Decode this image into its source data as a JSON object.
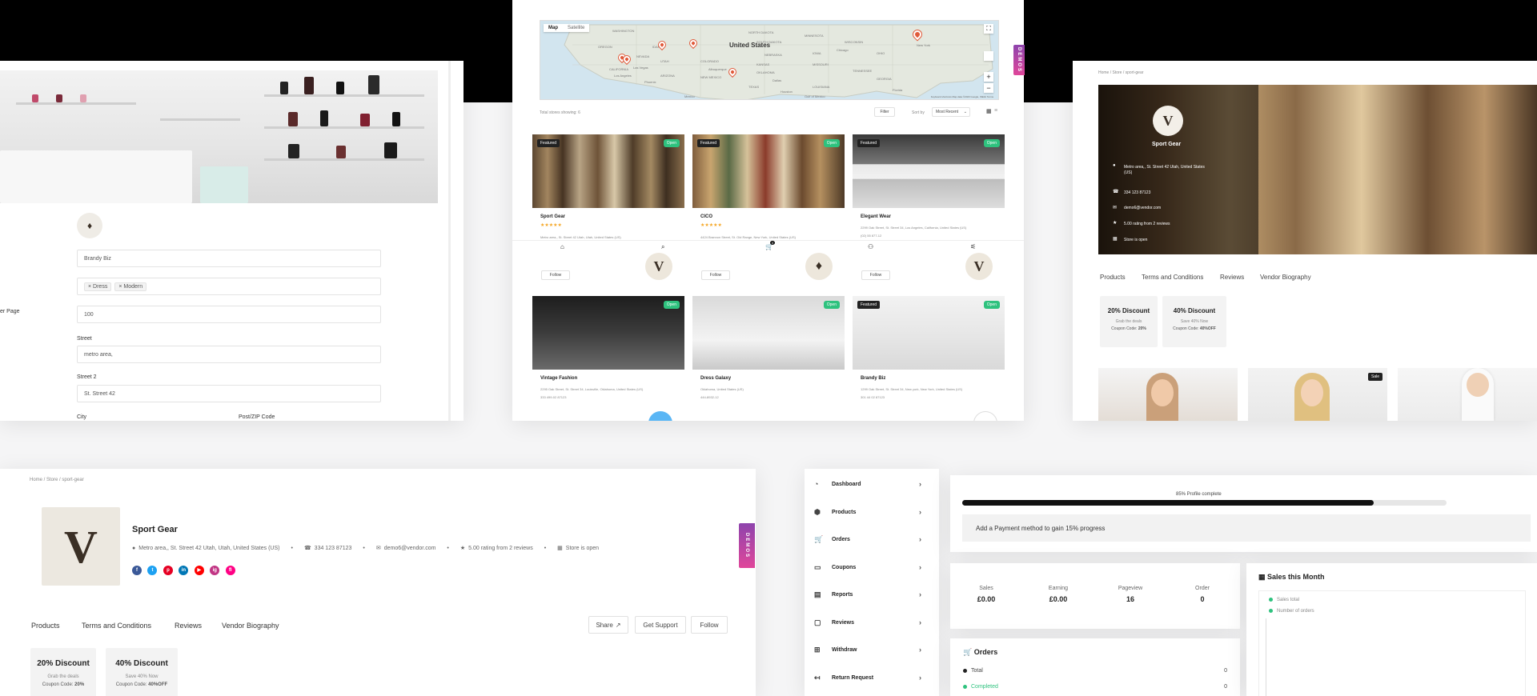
{
  "colors": {
    "accent_green": "#2ec27e",
    "star": "#f5a623",
    "demos_gradient_start": "#8e44ad",
    "demos_gradient_end": "#e0469a",
    "progress_fill": "#111111",
    "pin": "#e05a3a"
  },
  "settings_card": {
    "section_label": "er Page",
    "store_name": "Brandy Biz",
    "categories": [
      "Dress",
      "Modern"
    ],
    "per_page": "100",
    "street_label": "Street",
    "street_value": "metro area,",
    "street2_label": "Street 2",
    "street2_value": "St. Street 42",
    "city_label": "City",
    "zip_label": "Post/ZIP Code",
    "category_remove": "×",
    "logo_icon": "store-logo-icon"
  },
  "listing_card": {
    "map": {
      "tab_map": "Map",
      "tab_satellite": "Satellite",
      "country_label": "United States",
      "zoom_in": "+",
      "zoom_out": "−",
      "footer": "Keyboard shortcuts  Map data ©2023 Google, INEGI  Terms",
      "place_labels": [
        "WASHINGTON",
        "NORTH DAKOTA",
        "MINNESOTA",
        "OREGON",
        "IDAHO",
        "SOUTH DAKOTA",
        "WISCONSIN",
        "NEVADA",
        "NEBRASKA",
        "IOWA",
        "OHIO",
        "UTAH",
        "COLORADO",
        "KANSAS",
        "MISSOURI",
        "CALIFORNIA",
        "Las Vegas",
        "OKLAHOMA",
        "TENNESSEE",
        "ARIZONA",
        "NEW MEXICO",
        "Dallas",
        "GEORGIA",
        "TEXAS",
        "LOUISIANA",
        "Houston",
        "Phoenix",
        "Albuquerque",
        "New York",
        "Chicago",
        "Los Angeles",
        "Mexico",
        "Gulf of Mexico",
        "Florida"
      ]
    },
    "total_stores": "Total stores showing: 6",
    "filter_label": "Filter",
    "sort_label": "Sort by",
    "sort_value": "Most Recent",
    "featured_label": "Featured",
    "open_label": "Open",
    "follow_label": "Follow",
    "stars": "★★★★★",
    "nav_icons": [
      "home-icon",
      "search-icon",
      "cart-icon",
      "user-icon",
      "filter-icon"
    ],
    "cart_badge": "0",
    "stores": [
      {
        "name": "Sport Gear",
        "address": "Metro area,, St. Street 42 Utah, Utah, United States (US)",
        "phone": "",
        "featured": true,
        "rated": true
      },
      {
        "name": "CICO",
        "address": "4424 Brannon Street, St. Old Range, New York, United States (US)",
        "phone": "",
        "featured": true,
        "rated": true
      },
      {
        "name": "Elegant Wear",
        "address": "2299 Oak Street, St. Street 34, Los Angeles, California, United States (US)",
        "phone": "(02) 55 877-12",
        "featured": true,
        "rated": false
      },
      {
        "name": "Vintage Fashion",
        "address": "2295 Oak Street, St. Street 34, Louisville, Oklahoma, United States (US)",
        "phone": "333 499-02 87123",
        "featured": false,
        "rated": false
      },
      {
        "name": "Dress Galaxy",
        "address": "Oklahoma, United States (US)",
        "phone": "444-8932-12",
        "featured": false,
        "rated": false
      },
      {
        "name": "Brandy Biz",
        "address": "1299 Oak Street, St. Street 34, New york, New York, United States (US)",
        "phone": "301 44 02 87123",
        "featured": true,
        "rated": false
      }
    ]
  },
  "demos_label": "DEMOS",
  "profile_right": {
    "breadcrumb": "Home / Store / sport-gear",
    "name": "Sport Gear",
    "address": "Metro area,, St. Street 42 Utah, United States (US)",
    "phone": "334 123 87123",
    "email": "demo6@vendor.com",
    "rating": "5.00 rating from 2 reviews",
    "status": "Store is open",
    "tabs": [
      "Products",
      "Terms and Conditions",
      "Reviews",
      "Vendor Biography"
    ],
    "coupons": [
      {
        "title": "20% Discount",
        "sub": "Grab the deals",
        "code_label": "Coupon Code:",
        "code": "20%"
      },
      {
        "title": "40% Discount",
        "sub": "Save 40% Now",
        "code_label": "Coupon Code:",
        "code": "40%OFF"
      }
    ],
    "sale_label": "Sale"
  },
  "profile_bottom": {
    "breadcrumb": "Home / Store / sport-gear",
    "name": "Sport Gear",
    "address": "Metro area,, St. Street 42 Utah, Utah, United States (US)",
    "phone": "334 123 87123",
    "email": "demo6@vendor.com",
    "rating": "5.00 rating from 2 reviews",
    "status": "Store is open",
    "separator": "•",
    "social": [
      "f",
      "t",
      "p",
      "in",
      "▶",
      "ig",
      "fl"
    ],
    "tabs": [
      "Products",
      "Terms and Conditions",
      "Reviews",
      "Vendor Biography"
    ],
    "share": "Share",
    "support": "Get Support",
    "follow": "Follow",
    "coupons": [
      {
        "title": "20% Discount",
        "sub": "Grab the deals",
        "code_label": "Coupon Code:",
        "code": "20%"
      },
      {
        "title": "40% Discount",
        "sub": "Save 40% Now",
        "code_label": "Coupon Code:",
        "code": "40%OFF"
      }
    ]
  },
  "dashboard": {
    "menu": [
      {
        "label": "Dashboard",
        "icon": "dashboard-icon",
        "glyph": "◔"
      },
      {
        "label": "Products",
        "icon": "products-icon",
        "glyph": "⬢"
      },
      {
        "label": "Orders",
        "icon": "cart-icon",
        "glyph": "🛒"
      },
      {
        "label": "Coupons",
        "icon": "coupon-icon",
        "glyph": "▭"
      },
      {
        "label": "Reports",
        "icon": "reports-icon",
        "glyph": "▤"
      },
      {
        "label": "Reviews",
        "icon": "reviews-icon",
        "glyph": "▢"
      },
      {
        "label": "Withdraw",
        "icon": "withdraw-icon",
        "glyph": "⊞"
      },
      {
        "label": "Return Request",
        "icon": "return-icon",
        "glyph": "↤"
      }
    ],
    "chevron": "›",
    "progress_label": "85% Profile complete",
    "progress_value": 85,
    "payment_hint": "Add a Payment method to gain 15% progress",
    "stats": [
      {
        "label": "Sales",
        "value": "£0.00"
      },
      {
        "label": "Earning",
        "value": "£0.00"
      },
      {
        "label": "Pageview",
        "value": "16"
      },
      {
        "label": "Order",
        "value": "0"
      }
    ],
    "orders_title": "Orders",
    "orders": [
      {
        "label": "Total",
        "value": "0"
      },
      {
        "label": "Completed",
        "value": "0"
      }
    ],
    "chart_title": "Sales this Month",
    "legend": [
      "Sales total",
      "Number of orders"
    ]
  }
}
